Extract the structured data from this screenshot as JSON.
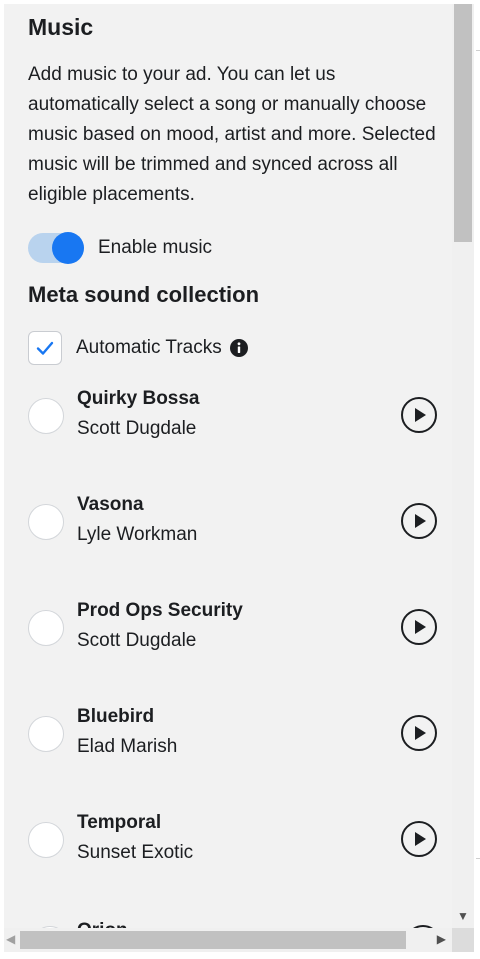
{
  "music": {
    "title": "Music",
    "description": "Add music to your ad. You can let us automatically select a song or manually choose music based on mood, artist and more. Selected music will be trimmed and synced across all eligible placements.",
    "enable_label": "Enable music",
    "enable_on": true
  },
  "collection": {
    "heading": "Meta sound collection",
    "automatic_label": "Automatic Tracks",
    "automatic_checked": true
  },
  "tracks": [
    {
      "name": "Quirky Bossa",
      "artist": "Scott Dugdale"
    },
    {
      "name": "Vasona",
      "artist": "Lyle Workman"
    },
    {
      "name": "Prod Ops Security",
      "artist": "Scott Dugdale"
    },
    {
      "name": "Bluebird",
      "artist": "Elad Marish"
    },
    {
      "name": "Temporal",
      "artist": "Sunset Exotic"
    },
    {
      "name": "Orion",
      "artist": ""
    }
  ],
  "colors": {
    "accent": "#1877f2",
    "toggle_track": "#b9d3ee",
    "panel_bg": "#f2f2f2"
  },
  "icons": {
    "play": "play-circle-icon",
    "info": "info-icon",
    "check": "checkmark-icon"
  }
}
